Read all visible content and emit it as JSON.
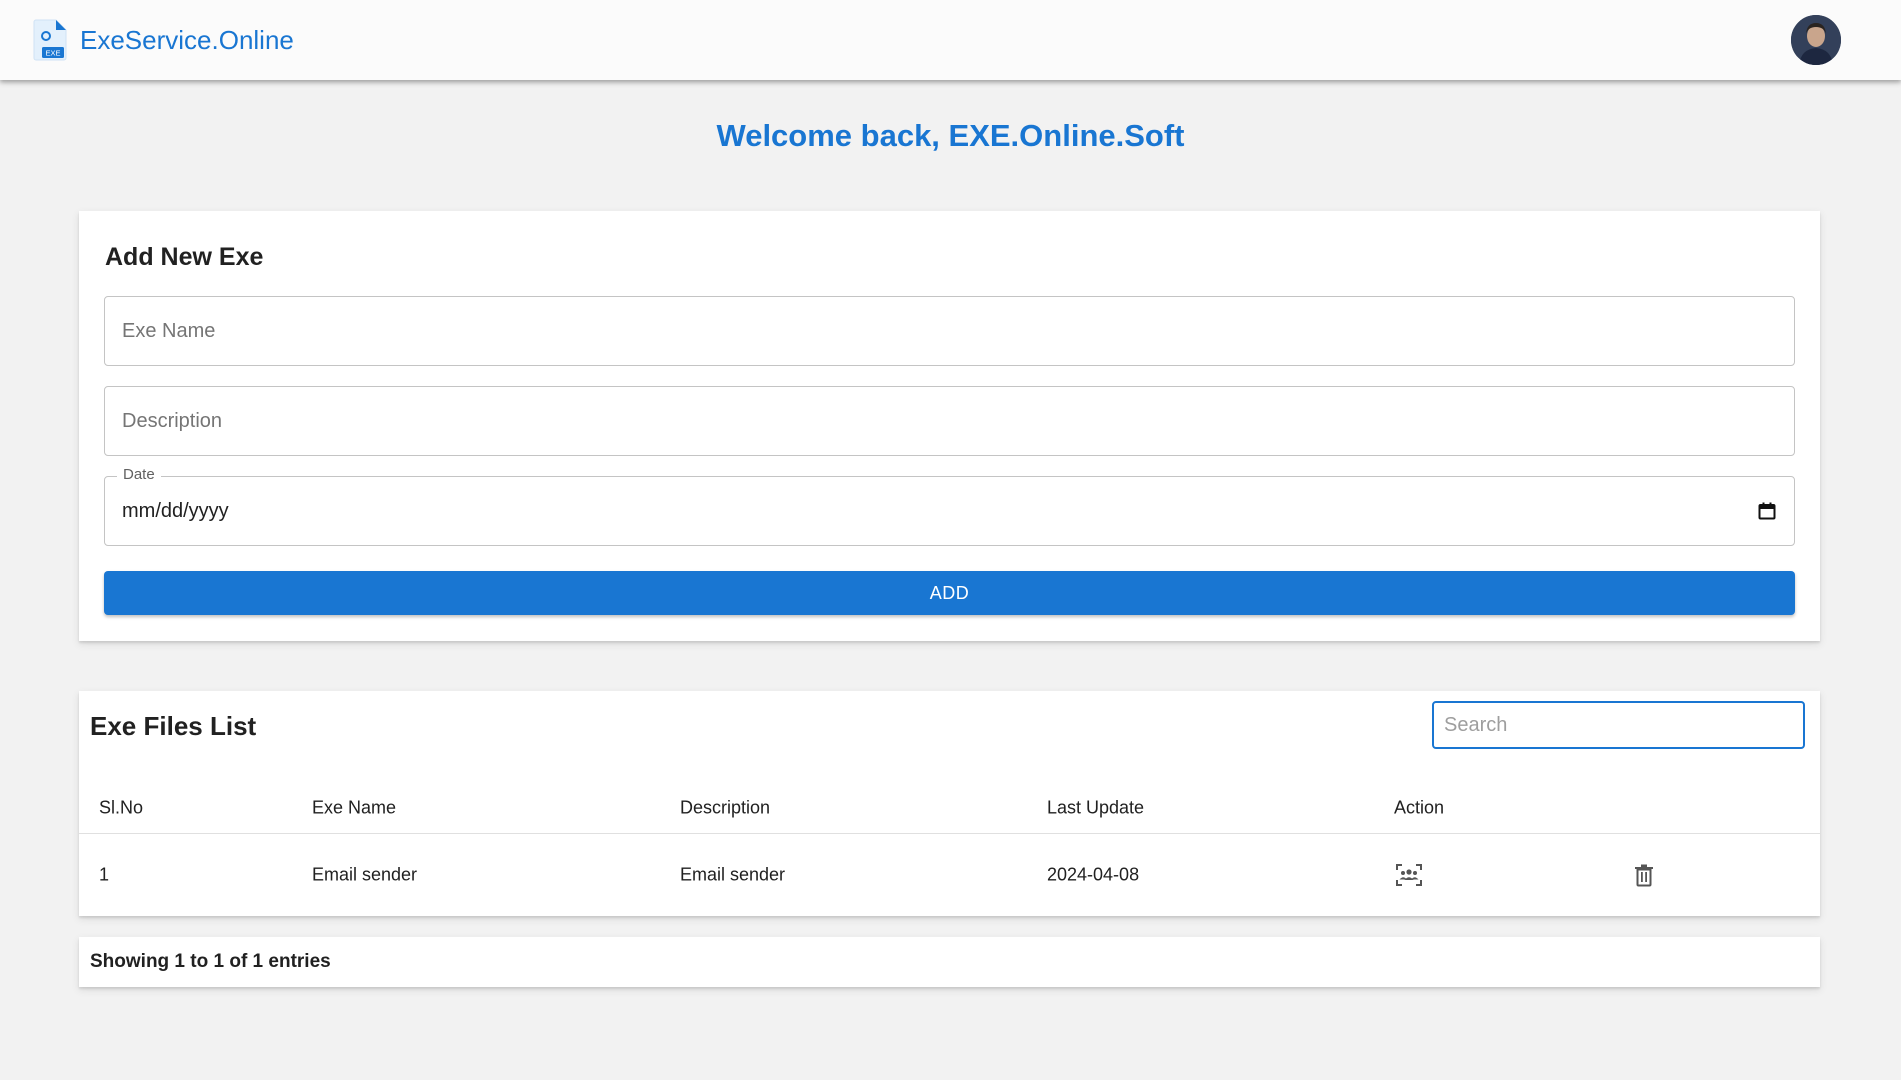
{
  "header": {
    "brand_name": "ExeService.Online",
    "brand_icon": "exe-file-icon",
    "brand_icon_badge": "EXE",
    "avatar_icon": "user-avatar"
  },
  "welcome": "Welcome back, EXE.Online.Soft",
  "form": {
    "title": "Add New Exe",
    "exe_name_placeholder": "Exe Name",
    "description_placeholder": "Description",
    "date_label": "Date",
    "date_value": "mm/dd/yyyy",
    "add_label": "ADD"
  },
  "list": {
    "title": "Exe Files List",
    "search_placeholder": "Search",
    "columns": [
      "Sl.No",
      "Exe Name",
      "Description",
      "Last Update",
      "Action"
    ],
    "rows": [
      {
        "sl": "1",
        "name": "Email sender",
        "description": "Email sender",
        "updated": "2024-04-08"
      }
    ],
    "footer": "Showing 1 to 1 of 1 entries"
  },
  "colors": {
    "primary": "#1976d2",
    "background": "#f2f2f2"
  }
}
